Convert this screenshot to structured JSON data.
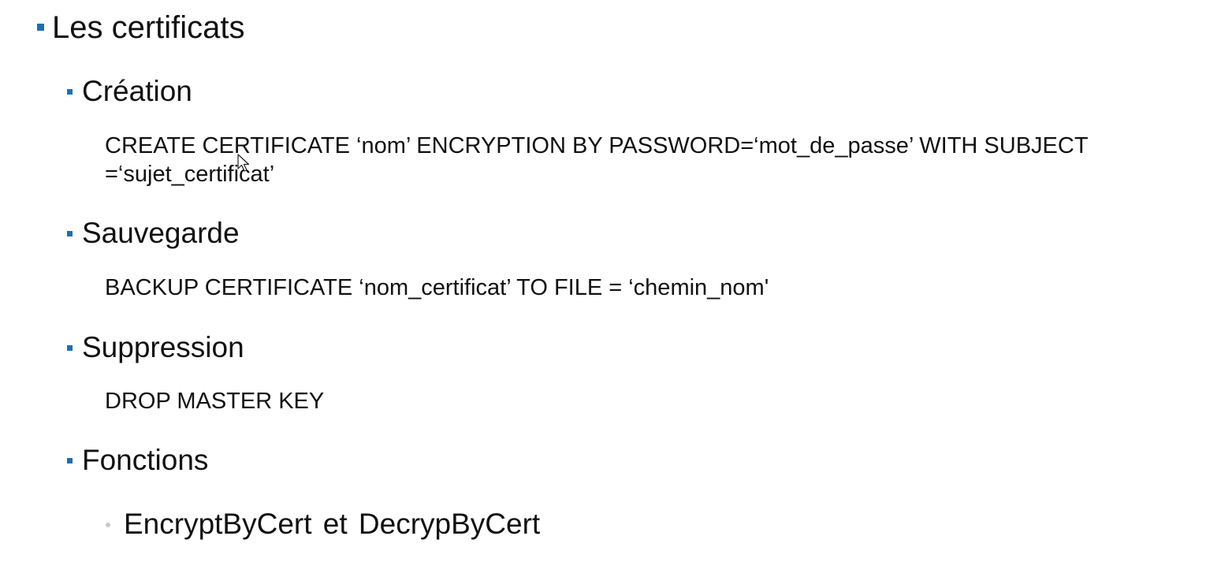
{
  "slide": {
    "title": "Les certificats",
    "sections": [
      {
        "heading": "Création",
        "code": [
          "CREATE CERTIFICATE ‘nom’ ENCRYPTION BY PASSWORD=‘mot_de_passe’ WITH SUBJECT",
          "=‘sujet_certificat’"
        ]
      },
      {
        "heading": "Sauvegarde",
        "code": [
          "BACKUP CERTIFICATE ‘nom_certificat’ TO FILE = ‘chemin_nom'"
        ]
      },
      {
        "heading": "Suppression",
        "code": [
          "DROP MASTER KEY"
        ]
      },
      {
        "heading": "Fonctions",
        "sub_items": [
          "EncryptByCert  et  DecrypByCert"
        ]
      }
    ]
  },
  "colors": {
    "bullet": "#1f6fb2",
    "sub_bullet": "#c8c8c8",
    "text": "#111111"
  }
}
